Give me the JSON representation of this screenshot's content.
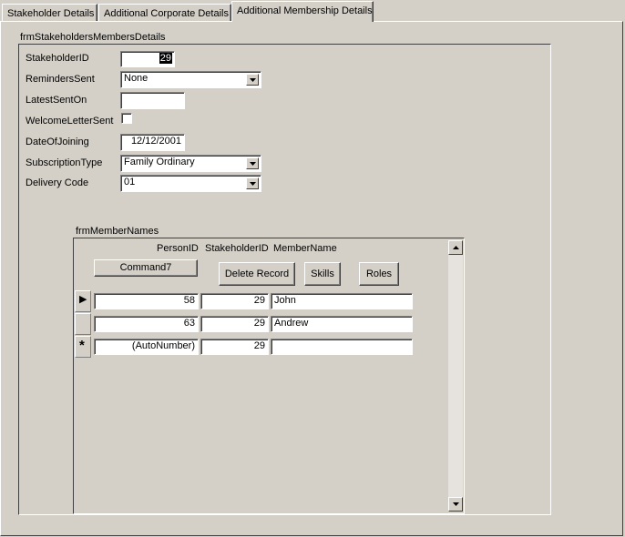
{
  "tabs": [
    {
      "label": "Stakeholder Details"
    },
    {
      "label": "Additional Corporate Details"
    },
    {
      "label": "Additional Membership Details"
    }
  ],
  "main_form": {
    "title": "frmStakeholdersMembersDetails",
    "fields": {
      "stakeholder_id": {
        "label": "StakeholderID",
        "value": "29"
      },
      "reminders_sent": {
        "label": "RemindersSent",
        "value": "None"
      },
      "latest_sent_on": {
        "label": "LatestSentOn",
        "value": ""
      },
      "welcome_letter_sent": {
        "label": "WelcomeLetterSent",
        "checked": false
      },
      "date_of_joining": {
        "label": "DateOfJoining",
        "value": "12/12/2001"
      },
      "subscription_type": {
        "label": "SubscriptionType",
        "value": "Family Ordinary"
      },
      "delivery_code": {
        "label": "Delivery Code",
        "value": "01"
      }
    }
  },
  "subform": {
    "title": "frmMemberNames",
    "columns": {
      "person_id": "PersonID",
      "stakeholder_id": "StakeholderID",
      "member_name": "MemberName"
    },
    "buttons": {
      "command7": "Command7",
      "delete_record": "Delete Record",
      "skills": "Skills",
      "roles": "Roles"
    },
    "rows": [
      {
        "person_id": "58",
        "stakeholder_id": "29",
        "member_name": "John"
      },
      {
        "person_id": "63",
        "stakeholder_id": "29",
        "member_name": "Andrew"
      },
      {
        "person_id": "(AutoNumber)",
        "stakeholder_id": "29",
        "member_name": ""
      }
    ],
    "selectors": {
      "current_record": "▶",
      "new_record": "*"
    }
  }
}
